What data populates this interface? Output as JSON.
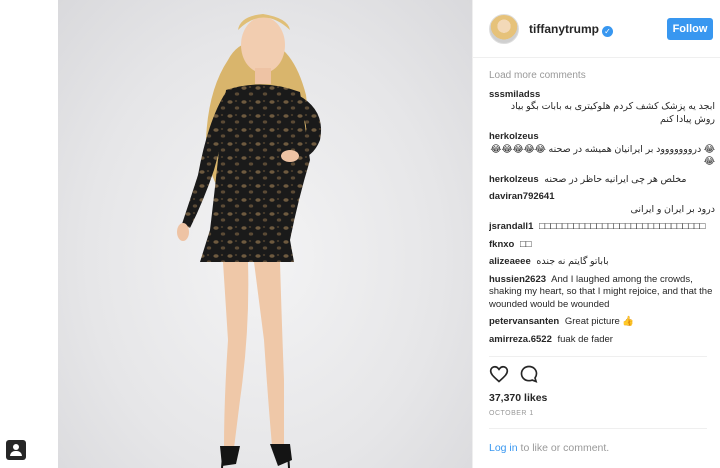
{
  "header": {
    "username": "tiffanytrump",
    "follow_label": "Follow"
  },
  "comments": {
    "load_more": "Load more comments",
    "items": [
      {
        "user": "sssmiladss",
        "text": "ابجد یه پزشک کشف کردم هلوکیتری به بابات بگو بیاد روش پیادا کنم"
      },
      {
        "user": "herkolzeus",
        "text": "😂 درووووووود بر ایرانیان همیشه در صحنه 😂😂😂😂😂😂"
      },
      {
        "user": "herkolzeus",
        "text": "مخلص هر چی ایرانیه حاظر در صحنه"
      },
      {
        "user": "daviran792641",
        "text": "درود بر ایران و ایرانی"
      },
      {
        "user": "jsrandall1",
        "text": "□□□□□□□□□□□□□□□□□□□□□□□□□□□□□"
      },
      {
        "user": "fknxo",
        "text": "□□"
      },
      {
        "user": "alizeaeee",
        "text": "باباتو گایتم نه جنده"
      },
      {
        "user": "hussien2623",
        "text": "And I laughed among the crowds, shaking my heart, so that I might rejoice, and that the wounded would be wounded"
      },
      {
        "user": "petervansanten",
        "text": "Great picture 👍"
      },
      {
        "user": "amirreza.6522",
        "text": "fuak de fader"
      }
    ]
  },
  "post": {
    "likes": "37,370 likes",
    "date": "OCTOBER 1",
    "login_link": "Log in",
    "login_rest": " to like or comment."
  },
  "icons": {
    "heart": "heart-icon",
    "comment": "comment-icon",
    "verified": "verified-badge-icon",
    "tag": "user-tag-icon"
  },
  "colors": {
    "accent": "#3897f0",
    "muted": "#999999",
    "text": "#262626"
  }
}
